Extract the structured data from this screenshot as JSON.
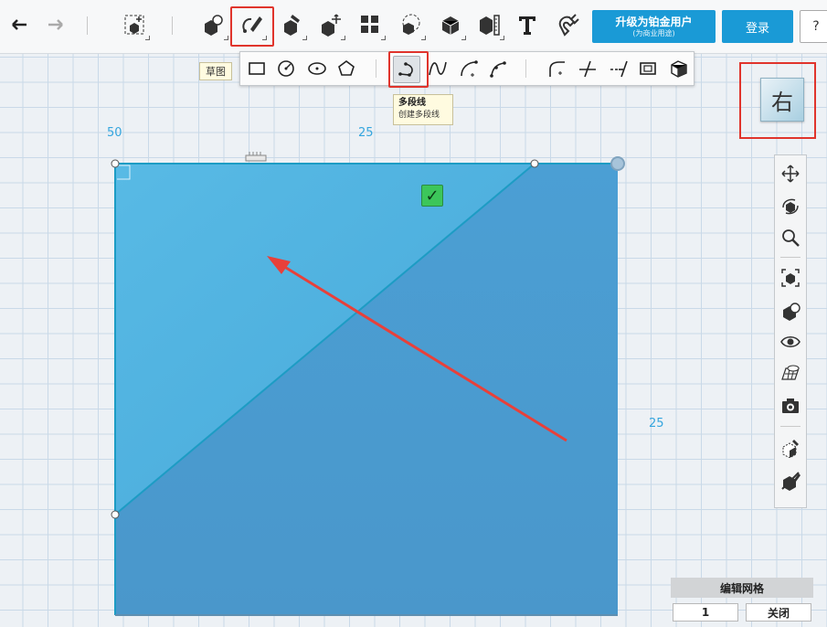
{
  "toolbar": {
    "tools": [
      {
        "name": "undo-icon"
      },
      {
        "name": "redo-icon"
      },
      {
        "name": "primitives-icon"
      },
      {
        "name": "shapes-icon"
      },
      {
        "name": "sketch-icon"
      },
      {
        "name": "construct-icon"
      },
      {
        "name": "modify-icon"
      },
      {
        "name": "pattern-icon"
      },
      {
        "name": "grouping-icon"
      },
      {
        "name": "combine-icon"
      },
      {
        "name": "measure-icon"
      },
      {
        "name": "text-icon"
      },
      {
        "name": "snap-icon"
      }
    ],
    "upgrade_label": "升级为铂金用户",
    "upgrade_sub": "(为商业用途)",
    "login_label": "登录",
    "help_label": "?"
  },
  "sketch_label": "草图",
  "tooltip": {
    "title": "多段线",
    "desc": "创建多段线"
  },
  "ruler": {
    "top_left": "50",
    "top_mid": "25",
    "right_mid": "25"
  },
  "viewcube": {
    "face_label": "右"
  },
  "grid_panel": {
    "title": "编辑网格",
    "value": "1",
    "close_label": "关闭"
  },
  "colors": {
    "accent": "#1a9ad6",
    "highlight": "#e0342c",
    "shape_fill": "#4a9fd5",
    "shape_light": "#56b7e3"
  }
}
